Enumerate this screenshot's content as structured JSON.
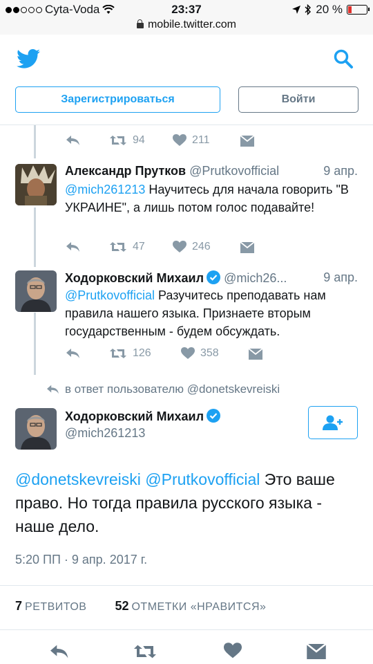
{
  "status_bar": {
    "carrier": "Cyta-Voda",
    "time": "23:37",
    "battery": "20 %",
    "battery_level": 0.2,
    "url": "mobile.twitter.com"
  },
  "header": {
    "signup_label": "Зарегистрироваться",
    "login_label": "Войти"
  },
  "colors": {
    "accent": "#1da1f2",
    "muted": "#657786",
    "icon": "#8899a6"
  },
  "top_actions": {
    "retweets": "94",
    "likes": "211"
  },
  "tweets": [
    {
      "name": "Александр Прутков",
      "handle": "@Prutkovofficial",
      "date": "9 апр.",
      "mention": "@mich261213",
      "text": " Научитесь для начала говорить \"В УКРАИНЕ\", а лишь потом голос подавайте!",
      "retweets": "47",
      "likes": "246"
    },
    {
      "name": "Ходорковский Михаил",
      "handle": "@mich26...",
      "date": "9 апр.",
      "mention": "@Prutkovofficial",
      "text": " Разучитесь преподавать нам правила нашего языка. Признаете вторым государственным - будем обсуждать.",
      "retweets": "126",
      "likes": "358"
    }
  ],
  "main_tweet": {
    "reply_context": "в ответ пользователю @donetskevreiski",
    "name": "Ходорковский Михаил",
    "handle": "@mich261213",
    "mention1": "@donetskevreiski",
    "mention2": "@Prutkovofficial",
    "text": " Это ваше право. Но тогда правила русского языка - наше дело.",
    "timestamp": "5:20 ПП · 9 апр. 2017 г.",
    "retweets_count": "7",
    "retweets_label": "РЕТВИТОВ",
    "likes_count": "52",
    "likes_label": "ОТМЕТКИ «НРАВИТСЯ»"
  }
}
